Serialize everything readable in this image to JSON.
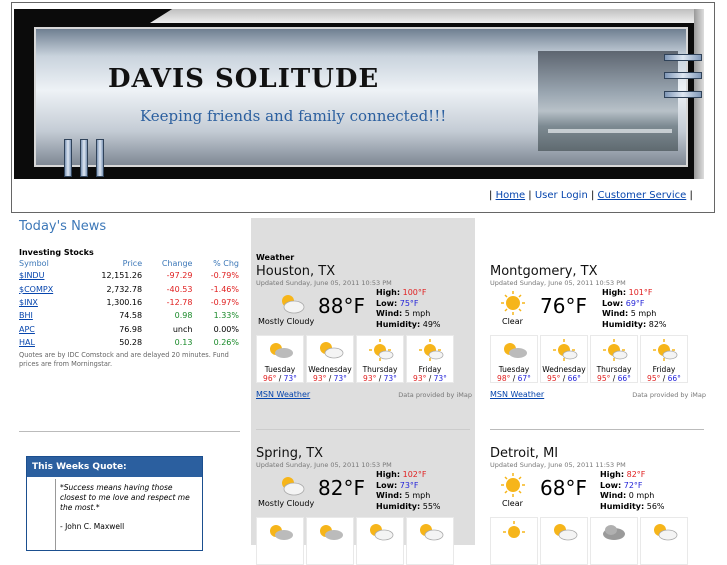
{
  "banner": {
    "title": "DAVIS SOLITUDE",
    "tagline": "Keeping friends and family connected!!!"
  },
  "nav": {
    "sep": "|",
    "home": "Home",
    "login": "User Login",
    "service": "Customer Service"
  },
  "news": {
    "title": "Today's News"
  },
  "stocks": {
    "title": "Investing Stocks",
    "headers": {
      "symbol": "Symbol",
      "price": "Price",
      "change": "Change",
      "pct": "% Chg"
    },
    "rows": [
      {
        "symbol": "$INDU",
        "price": "12,151.26",
        "change": "-97.29",
        "pct": "-0.79%"
      },
      {
        "symbol": "$COMPX",
        "price": "2,732.78",
        "change": "-40.53",
        "pct": "-1.46%"
      },
      {
        "symbol": "$INX",
        "price": "1,300.16",
        "change": "-12.78",
        "pct": "-0.97%"
      },
      {
        "symbol": "BHI",
        "price": "74.58",
        "change": "0.98",
        "pct": "1.33%"
      },
      {
        "symbol": "APC",
        "price": "76.98",
        "change": "unch",
        "pct": "0.00%"
      },
      {
        "symbol": "HAL",
        "price": "50.28",
        "change": "0.13",
        "pct": "0.26%"
      }
    ],
    "disclaimer": "Quotes are by IDC Comstock and are delayed 20 minutes. Fund prices are from Morningstar."
  },
  "quote": {
    "title": "This Weeks Quote:",
    "text": "*Success means having those closest to me love and respect me the most.*",
    "author": "- John C. Maxwell"
  },
  "weather_label": "Weather",
  "weather": [
    {
      "city": "Houston, TX",
      "updated": "Updated Sunday, June 05, 2011 10:53 PM",
      "condition": "Mostly Cloudy",
      "temp": "88°F",
      "high": "100°F",
      "low": "75°F",
      "wind": "5 mph",
      "humidity": "49%",
      "forecast": [
        {
          "day": "Tuesday",
          "hi": "96°",
          "lo": "73°",
          "icon": "cloudy-sun-icon"
        },
        {
          "day": "Wednesday",
          "hi": "93°",
          "lo": "73°",
          "icon": "partly-cloudy-icon"
        },
        {
          "day": "Thursday",
          "hi": "93°",
          "lo": "73°",
          "icon": "sunny-icon"
        },
        {
          "day": "Friday",
          "hi": "93°",
          "lo": "73°",
          "icon": "sunny-icon"
        }
      ],
      "link": "MSN Weather",
      "credit": "Data provided by iMap"
    },
    {
      "city": "Montgomery, TX",
      "updated": "Updated Sunday, June 05, 2011 10:53 PM",
      "condition": "Clear",
      "temp": "76°F",
      "high": "101°F",
      "low": "69°F",
      "wind": "5 mph",
      "humidity": "82%",
      "forecast": [
        {
          "day": "Tuesday",
          "hi": "98°",
          "lo": "67°",
          "icon": "cloudy-sun-icon"
        },
        {
          "day": "Wednesday",
          "hi": "95°",
          "lo": "66°",
          "icon": "sunny-icon"
        },
        {
          "day": "Thursday",
          "hi": "95°",
          "lo": "66°",
          "icon": "sunny-icon"
        },
        {
          "day": "Friday",
          "hi": "95°",
          "lo": "66°",
          "icon": "sunny-icon"
        }
      ],
      "link": "MSN Weather",
      "credit": "Data provided by iMap"
    },
    {
      "city": "Spring, TX",
      "updated": "Updated Sunday, June 05, 2011 10:53 PM",
      "condition": "Mostly Cloudy",
      "temp": "82°F",
      "high": "102°F",
      "low": "73°F",
      "wind": "5 mph",
      "humidity": "55%",
      "forecast": [
        {
          "icon": "cloudy-sun-icon"
        },
        {
          "icon": "cloudy-sun-icon"
        },
        {
          "icon": "partly-cloudy-icon"
        },
        {
          "icon": "partly-cloudy-icon"
        }
      ]
    },
    {
      "city": "Detroit, MI",
      "updated": "Updated Sunday, June 05, 2011 11:53 PM",
      "condition": "Clear",
      "temp": "68°F",
      "high": "82°F",
      "low": "72°F",
      "wind": "0 mph",
      "humidity": "56%",
      "forecast": [
        {
          "icon": "sunny-icon"
        },
        {
          "icon": "partly-cloudy-icon"
        },
        {
          "icon": "cloudy-icon"
        },
        {
          "icon": "partly-cloudy-icon"
        }
      ]
    }
  ],
  "labels": {
    "high": "High:",
    "low": "Low:",
    "wind": "Wind:",
    "humidity": "Humidity:"
  },
  "colors": {
    "accent": "#3d78b8",
    "quote_header": "#2b5f9f",
    "negative": "#e02020",
    "positive": "#1a8a2a",
    "high_temp": "#e02020",
    "low_temp": "#2424d8"
  }
}
